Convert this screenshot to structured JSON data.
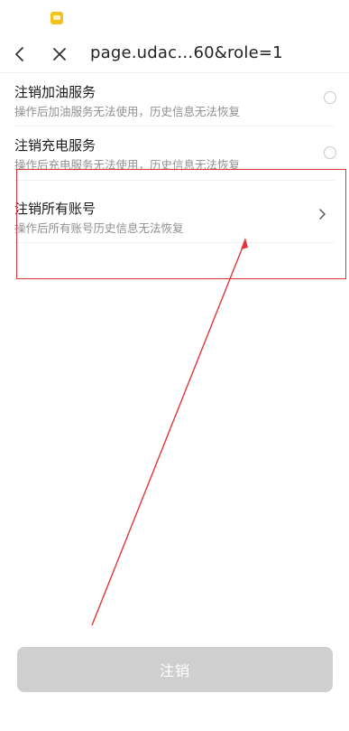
{
  "nav": {
    "title": "page.udac…60&role=1"
  },
  "options": [
    {
      "title": "注销加油服务",
      "description": "操作后加油服务无法使用，历史信息无法恢复"
    },
    {
      "title": "注销充电服务",
      "description": "操作后充电服务无法使用，历史信息无法恢复"
    },
    {
      "title": "注销所有账号",
      "description": "操作后所有账号历史信息无法恢复"
    }
  ],
  "footer": {
    "cancel_label": "注销"
  },
  "colors": {
    "highlight": "#e2353a",
    "button_disabled": "#cfcfcf",
    "notification_icon": "#f5c21b"
  }
}
